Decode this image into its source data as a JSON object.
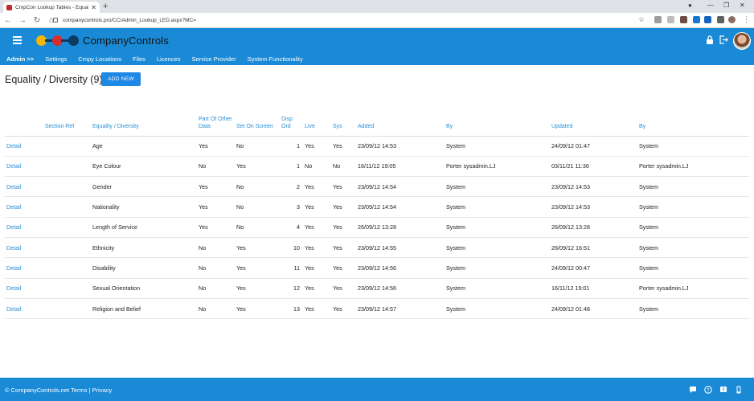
{
  "browser": {
    "tab_title": "CmpCon Lookup Tables - Equali",
    "url": "companycontrols.pro/CC/Admin_Lookup_LED.aspx?MC="
  },
  "app": {
    "brand": "CompanyControls",
    "accent": "#1a8ad6",
    "logo_colors": [
      "#f2b705",
      "#d32f2f",
      "#0d3b66"
    ]
  },
  "menu": {
    "items": [
      "Admin >>",
      "Settings",
      "Cmpy Locations",
      "Files",
      "Licences",
      "Service Provider",
      "System Functionality"
    ]
  },
  "page": {
    "title": "Equality / Diversity (9)",
    "add_button": "ADD NEW"
  },
  "table": {
    "headers": [
      "",
      "Section Ref",
      "Equality / Diversity",
      "Part Of Other Data",
      "Set On Screen",
      "Disp Ord",
      "Live",
      "Sys",
      "Added",
      "By",
      "Updated",
      "By"
    ],
    "rows": [
      [
        "Detail",
        "",
        "Age",
        "Yes",
        "No",
        "1",
        "Yes",
        "Yes",
        "23/09/12 14:53",
        "System",
        "24/09/12 01:47",
        "System"
      ],
      [
        "Detail",
        "",
        "Eye Colour",
        "No",
        "Yes",
        "1",
        "No",
        "No",
        "16/11/12 19:05",
        "Porter sysadmin.LJ",
        "03/11/21 11:36",
        "Porter sysadmin.LJ"
      ],
      [
        "Detail",
        "",
        "Gender",
        "Yes",
        "No",
        "2",
        "Yes",
        "Yes",
        "23/09/12 14:54",
        "System",
        "23/09/12 14:53",
        "System"
      ],
      [
        "Detail",
        "",
        "Nationality",
        "Yes",
        "No",
        "3",
        "Yes",
        "Yes",
        "23/09/12 14:54",
        "System",
        "23/09/12 14:53",
        "System"
      ],
      [
        "Detail",
        "",
        "Length of Service",
        "Yes",
        "No",
        "4",
        "Yes",
        "Yes",
        "26/09/12 13:28",
        "System",
        "26/09/12 13:28",
        "System"
      ],
      [
        "Detail",
        "",
        "Ethnicity",
        "No",
        "Yes",
        "10",
        "Yes",
        "Yes",
        "23/09/12 14:55",
        "System",
        "26/09/12 16:51",
        "System"
      ],
      [
        "Detail",
        "",
        "Disability",
        "No",
        "Yes",
        "11",
        "Yes",
        "Yes",
        "23/09/12 14:56",
        "System",
        "24/09/12 00:47",
        "System"
      ],
      [
        "Detail",
        "",
        "Sexual Orientation",
        "No",
        "Yes",
        "12",
        "Yes",
        "Yes",
        "23/09/12 14:56",
        "System",
        "16/11/12 19:01",
        "Porter sysadmin.LJ"
      ],
      [
        "Detail",
        "",
        "Religion and Belief",
        "No",
        "Yes",
        "13",
        "Yes",
        "Yes",
        "23/09/12 14:57",
        "System",
        "24/09/12 01:48",
        "System"
      ]
    ]
  },
  "footer": {
    "copy": "© CompanyControls.net",
    "terms": "Terms",
    "sep": "|",
    "privacy": "Privacy"
  },
  "icons": {
    "header": [
      "lock-icon",
      "logout-icon"
    ],
    "footer": [
      "chat-icon",
      "help-icon",
      "alert-icon",
      "mobile-icon"
    ]
  }
}
